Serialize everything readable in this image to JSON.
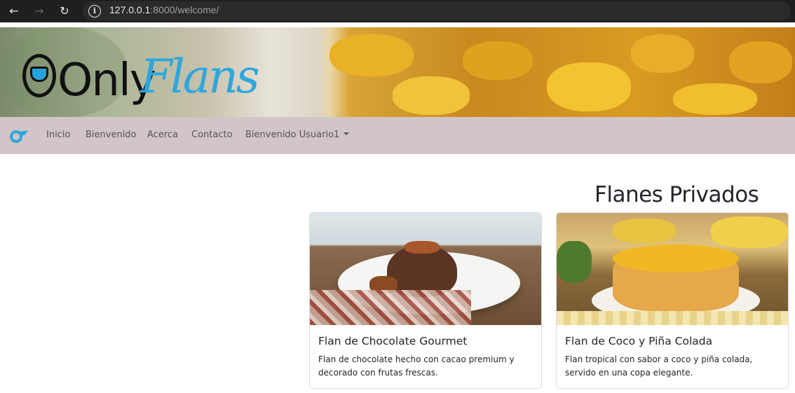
{
  "browser": {
    "url_host": "127.0.0.1",
    "url_rest": ":8000/welcome/"
  },
  "banner": {
    "logo_left": "Only",
    "logo_right": "Flans"
  },
  "navbar": {
    "items": [
      {
        "label": "Inicio"
      },
      {
        "label": "Bienvenido"
      },
      {
        "label": "Acerca"
      },
      {
        "label": "Contacto"
      },
      {
        "label": "Bienvenido Usuario1"
      }
    ],
    "colors": {
      "background": "#d2c5c7",
      "brand": "#2da7dd"
    }
  },
  "main": {
    "heading": "Flanes Privados",
    "cards": [
      {
        "title": "Flan de Chocolate Gourmet",
        "text": "Flan de chocolate hecho con cacao premium y decorado con frutas frescas."
      },
      {
        "title": "Flan de Coco y Piña Colada",
        "text": "Flan tropical con sabor a coco y piña colada, servido en una copa elegante."
      }
    ]
  }
}
